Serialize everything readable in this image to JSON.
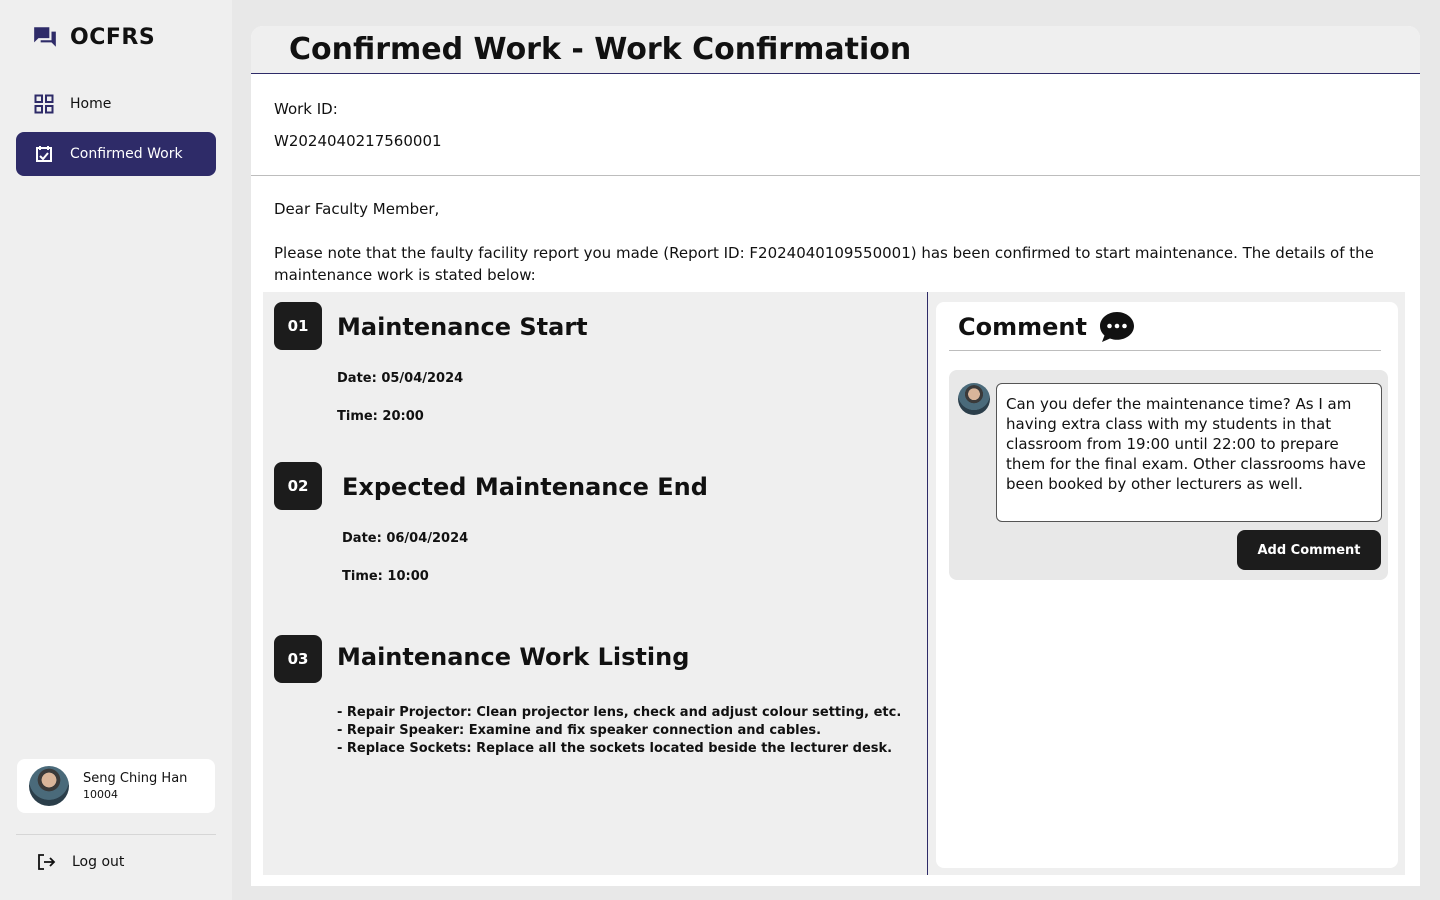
{
  "app": {
    "name": "OCFRS"
  },
  "sidebar": {
    "items": [
      {
        "label": "Home",
        "icon": "grid-icon",
        "active": false
      },
      {
        "label": "Confirmed Work",
        "icon": "confirmed-work-icon",
        "active": true
      }
    ],
    "user": {
      "name": "Seng Ching Han",
      "id": "10004"
    },
    "logout_label": "Log out"
  },
  "page": {
    "title": "Confirmed Work - Work Confirmation",
    "work_id_label": "Work ID:",
    "work_id": "W2024040217560001",
    "greeting": "Dear Faculty Member,",
    "message": "Please note that the faulty facility report you made (Report ID: F2024040109550001) has been confirmed to start maintenance. The details of the maintenance work is stated below:"
  },
  "steps": [
    {
      "number": "01",
      "title": "Maintenance Start",
      "date": "Date: 05/04/2024",
      "time": "Time: 20:00"
    },
    {
      "number": "02",
      "title": "Expected Maintenance End",
      "date": "Date: 06/04/2024",
      "time": "Time: 10:00"
    },
    {
      "number": "03",
      "title": "Maintenance Work Listing",
      "items": [
        "- Repair Projector: Clean projector lens, check and adjust colour setting, etc.",
        "- Repair Speaker: Examine and fix speaker connection and cables.",
        "- Replace Sockets: Replace all the sockets located beside the lecturer desk."
      ]
    }
  ],
  "comment": {
    "title": "Comment",
    "text": "Can you defer the maintenance time? As I am having extra class with my students in that classroom from 19:00 until 22:00 to prepare them for the final exam. Other classrooms have been booked by other lecturers as well.",
    "button_label": "Add Comment"
  },
  "colors": {
    "accent": "#2e2b68",
    "dark": "#1c1c1c"
  }
}
